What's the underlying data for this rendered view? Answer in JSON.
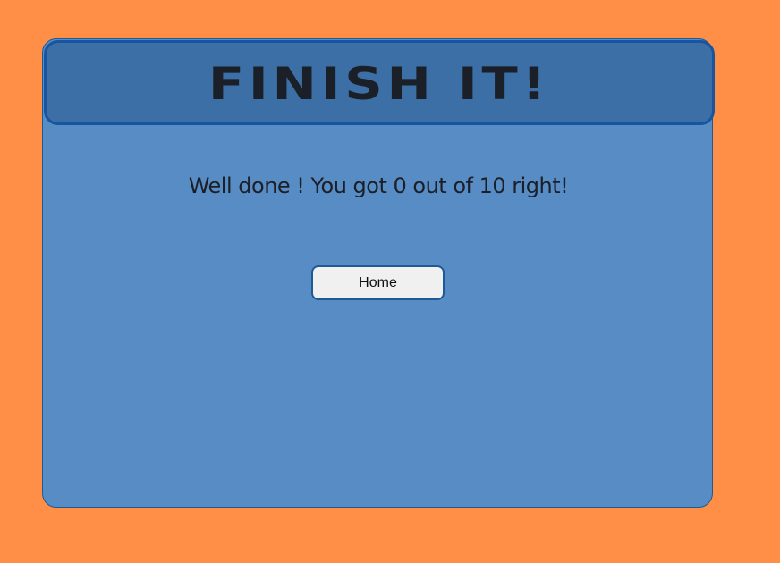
{
  "header": {
    "title": "Finish it!"
  },
  "result": {
    "message": "Well done ! You got 0 out of 10 right!"
  },
  "actions": {
    "home_label": "Home"
  },
  "colors": {
    "background": "#ff8f47",
    "panel": "#588cc5",
    "header": "#3b6fa5",
    "border": "#1755a0",
    "button": "#f0f0f0"
  }
}
